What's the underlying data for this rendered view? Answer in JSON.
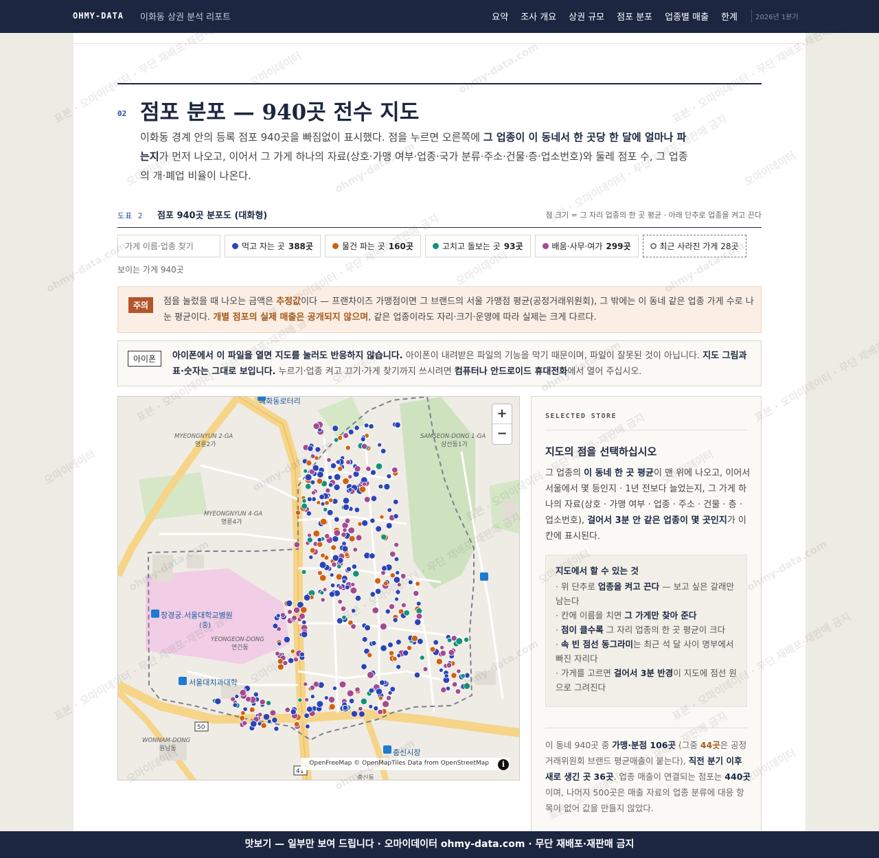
{
  "nav": {
    "brand": "OHMY-DATA",
    "report_title": "이화동 상권 분석 리포트",
    "links": [
      "요약",
      "조사 개요",
      "상권 규모",
      "점포 분포",
      "업종별 매출",
      "한계"
    ],
    "period": "2026년 1분기"
  },
  "section": {
    "number": "02",
    "title": "점포 분포 — 940곳 전수 지도",
    "lead_1": "이화동 경계 안의 등록 점포 940곳을 빠짐없이 표시했다. 점을 누르면 오른쪽에 ",
    "lead_bold": "그 업종이 이 동네서 한 곳당 한 달에 얼마나 파는지",
    "lead_2": "가 먼저 나오고, 이어서 그 가게 하나의 자료(상호·가맹 여부·업종·국가 분류·주소·건물·층·업소번호)와 둘레 점포 수, 그 업종의 개·폐업 비율이 나온다."
  },
  "figure": {
    "number": "도표 2",
    "title": "점포 940곳 분포도 (대화형)",
    "note": "점 크기 = 그 자리 업종의 한 곳 평균 · 아래 단추로 업종을 켜고 끈다"
  },
  "controls": {
    "search_placeholder": "가게 이름·업종 찾기",
    "chips": [
      {
        "label": "먹고 자는 곳",
        "count": "388곳",
        "color": "#2b45b8"
      },
      {
        "label": "물건 파는 곳",
        "count": "160곳",
        "color": "#d0620f"
      },
      {
        "label": "고치고 돌보는 곳",
        "count": "93곳",
        "color": "#14937a"
      },
      {
        "label": "배움·사무·여가",
        "count": "299곳",
        "color": "#a24a92"
      }
    ],
    "closed_label": "최근 사라진 가게 28곳",
    "visible_count": "보이는 가게 940곳"
  },
  "warning": {
    "tag": "주의",
    "t1": "점을 눌렀을 때 나오는 금액은 ",
    "h1": "추정값",
    "t2": "이다 — 프랜차이즈 가맹점이면 그 브랜드의 서울 가맹점 평균(공정거래위원회), 그 밖에는 이 동네 같은 업종 가게 수로 나눈 평균이다. ",
    "h2": "개별 점포의 실제 매출은 공개되지 않으며",
    "t3": ", 같은 업종이라도 자리·크기·운영에 따라 실제는 크게 다르다."
  },
  "ios": {
    "tag": "아이폰",
    "b1": "아이폰에서 이 파일을 열면 지도를 눌러도 반응하지 않습니다.",
    "t1": " 아이폰이 내려받은 파일의 기능을 막기 때문이며, 파일이 잘못된 것이 아닙니다. ",
    "b2": "지도 그림과 표·숫자는 그대로 보입니다.",
    "t2": " 누르기·업종 켜고 끄기·가게 찾기까지 쓰시려면 ",
    "b3": "컴퓨터나 안드로이드 휴대전화",
    "t3": "에서 열어 주십시오."
  },
  "map": {
    "labels": {
      "hyehwa_rotary": "혜화동로터리",
      "myeongnyun2_en": "MYEONGNYUN 2-GA",
      "myeongnyun2_ko": "명륜2가",
      "samseon_en": "SAMSEON-DONG 1-GA",
      "samseon_ko": "삼선동1가",
      "myeongnyun4_en": "MYEONGNYUN 4-GA",
      "myeongnyun4_ko": "명륜4가",
      "hospital_1": "창경궁.서울대학교병원",
      "hospital_2": "(중)",
      "yeongeon_en": "YEONGEON-DONG",
      "yeongeon_ko": "연건동",
      "snu_dental": "서울대치과대학",
      "route_50": "50",
      "wonnam_en": "WONNAM-DONG",
      "wonnam_ko": "원남동",
      "route_41": "41",
      "chungsin_market": "충신시장",
      "chungsin": "충신동"
    },
    "zoom_in": "+",
    "zoom_out": "−",
    "attribution": "OpenFreeMap © OpenMapTiles Data from OpenStreetMap",
    "info": "i"
  },
  "side": {
    "kicker": "SELECTED STORE",
    "title": "지도의 점을 선택하십시오",
    "d1": "그 업종의 ",
    "db1": "이 동네 한 곳 평균",
    "d2": "이 맨 위에 나오고, 이어서 서울에서 몇 등인지 · 1년 전보다 늘었는지, 그 가게 하나의 자료(상호 · 가맹 여부 · 업종 · 주소 · 건물 · 층 · 업소번호), ",
    "db2": "걸어서 3분 안 같은 업종이 몇 곳인지",
    "d3": "가 이 칸에 표시된다.",
    "howto_title": "지도에서 할 수 있는 것",
    "h1a": "· 위 단추로 ",
    "h1b": "업종을 켜고 끈다",
    "h1c": " — 보고 싶은 갈래만 남는다",
    "h2a": "· 칸에 이름을 치면 ",
    "h2b": "그 가게만 찾아 준다",
    "h2c": "",
    "h3a": "· ",
    "h3b": "점이 클수록",
    "h3c": " 그 자리 업종의 한 곳 평균이 크다",
    "h4a": "· ",
    "h4b": "속 빈 점선 동그라미",
    "h4c": "는 최근 석 달 사이 명부에서 빠진 자리다",
    "h5a": "· 가게를 고르면 ",
    "h5b": "걸어서 3분 반경",
    "h5c": "이 지도에 점선 원으로 그려진다",
    "s1": "이 동네 940곳 중 ",
    "sb1": "가맹·분점 106곳",
    "s2": " (그중 ",
    "so1": "44곳",
    "s3": "은 공정거래위원회 브랜드 평균매출이 붙는다), ",
    "sb2": "직전 분기 이후 새로 생긴 곳 36곳",
    "s4": ". 업종 매출이 연결되는 점포는 ",
    "sb3": "440곳",
    "s5": "이며, 나머지 500곳은 매출 자료의 업종 분류에 대응 항목이 없어 값을 만들지 않았다."
  },
  "footer": {
    "text": "맛보기 — 일부만 보여 드립니다 · 오마이데이터 ohmy-data.com · 무단 재배포·재판매 금지"
  },
  "watermark": {
    "text": "표본 · 오마이데이터 · 무단 재배포·재판매 금지",
    "text_short": "오마이데이터",
    "text_site": "ohmy-data.com"
  }
}
